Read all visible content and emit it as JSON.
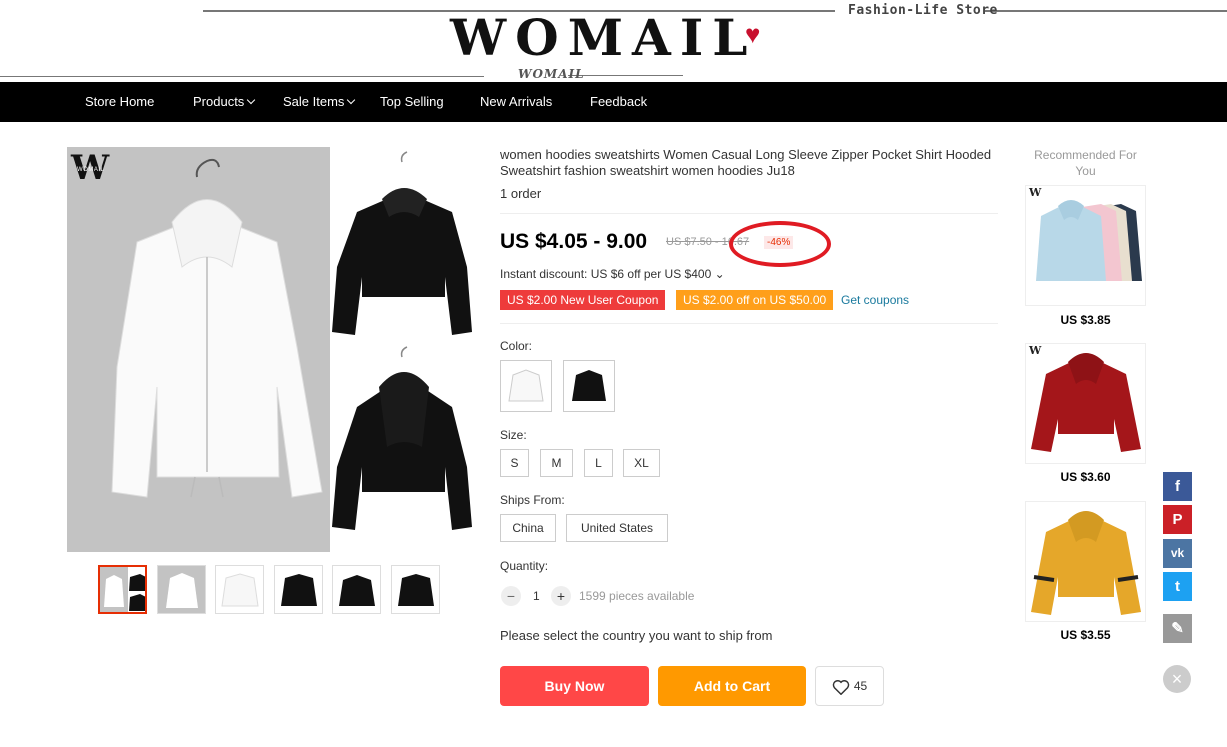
{
  "header": {
    "tagline": "Fashion-Life Store",
    "logo": "WOMAIL",
    "heart": "♥",
    "sublogo": "WOMAIL"
  },
  "nav": {
    "items": [
      {
        "label": "Store Home"
      },
      {
        "label": "Products"
      },
      {
        "label": "Sale Items"
      },
      {
        "label": "Top Selling"
      },
      {
        "label": "New Arrivals"
      },
      {
        "label": "Feedback"
      }
    ]
  },
  "gallery": {
    "watermark": "W",
    "watermark_small": "WOMAIL"
  },
  "product": {
    "title": "women hoodies sweatshirts Women Casual Long Sleeve Zipper Pocket Shirt Hooded Sweatshirt fashion sweatshirt women hoodies Ju18",
    "orders": "1 order",
    "price": "US $4.05 - 9.00",
    "old_price": "US $7.50 - 16.67",
    "discount": "-46%",
    "instant_discount": "Instant discount: US $6 off per US $400 ⌄",
    "coupons": [
      "US $2.00 New User Coupon",
      "US $2.00 off on US $50.00"
    ],
    "get_coupons": "Get coupons",
    "color_label": "Color:",
    "size_label": "Size:",
    "sizes": [
      "S",
      "M",
      "L",
      "XL"
    ],
    "ships_label": "Ships From:",
    "ships": [
      "China",
      "United States"
    ],
    "quantity_label": "Quantity:",
    "quantity": "1",
    "minus": "−",
    "plus": "+",
    "available": "1599 pieces available",
    "ship_msg": "Please select the country you want to ship from",
    "buy_now": "Buy Now",
    "add_to_cart": "Add to Cart",
    "wishlist_count": "45"
  },
  "recommended": {
    "title": "Recommended For You",
    "watermark": "W",
    "items": [
      {
        "price": "US $3.85"
      },
      {
        "price": "US $3.60"
      },
      {
        "price": "US $3.55"
      }
    ]
  },
  "social": {
    "facebook": "f",
    "pinterest": "P",
    "vk": "vk",
    "twitter": "t",
    "edit": "✎",
    "close": "×"
  },
  "colors": {
    "buy_now": "#ff4747",
    "add_to_cart": "#ff9900",
    "coupon_red": "#ee3b3b",
    "coupon_orange": "#ff9f1a",
    "facebook": "#3b5998",
    "pinterest": "#cb2027",
    "vk": "#4c75a3",
    "twitter": "#1da1f2",
    "edit": "#999999"
  }
}
